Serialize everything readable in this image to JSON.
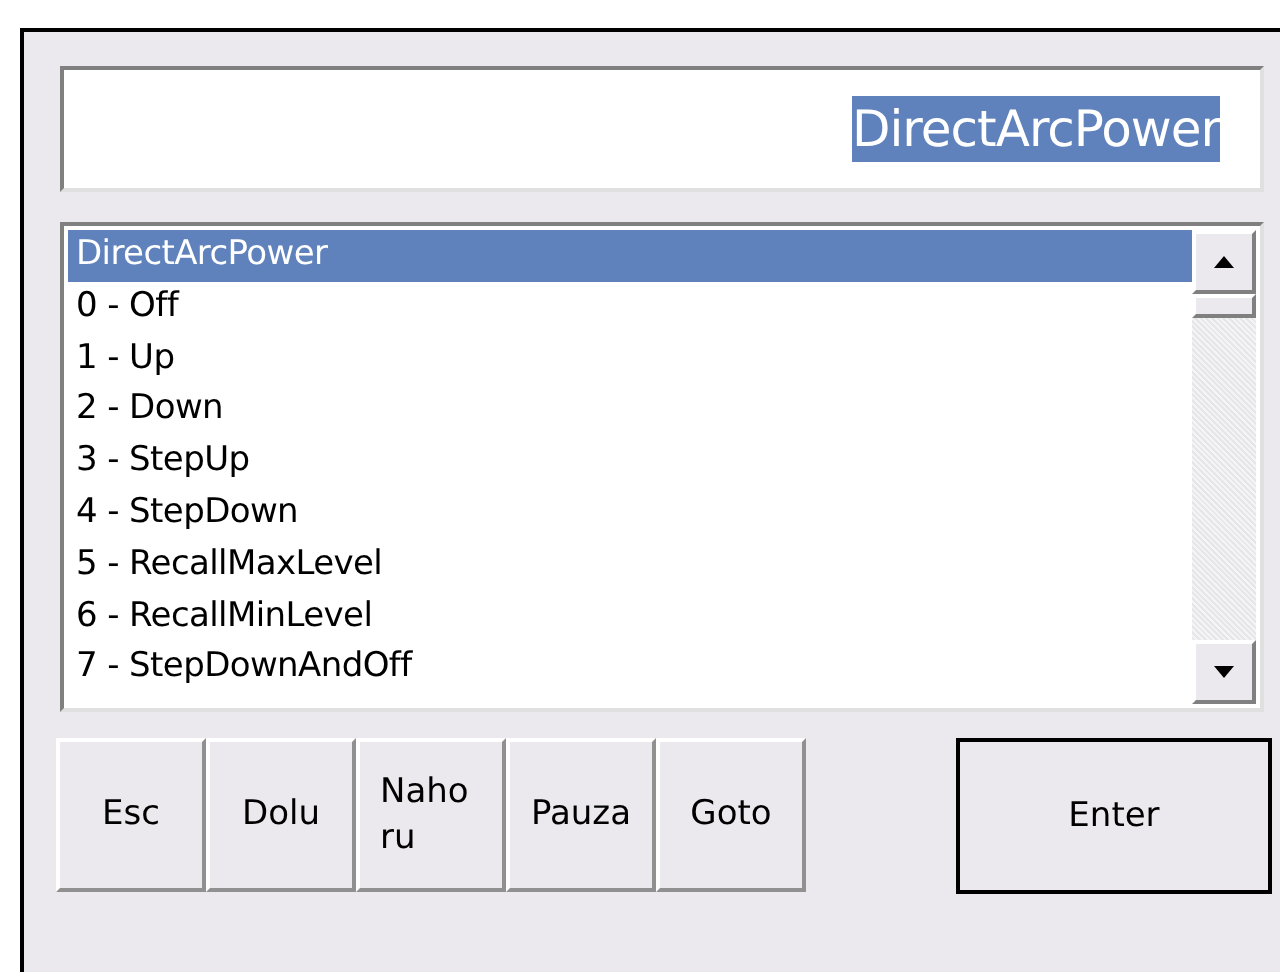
{
  "input": {
    "value": "DirectArcPower",
    "selected": true
  },
  "list": {
    "items": [
      {
        "label": "DirectArcPower",
        "selected": true
      },
      {
        "label": "0 - Off",
        "selected": false
      },
      {
        "label": "1 - Up",
        "selected": false
      },
      {
        "label": "2 - Down",
        "selected": false
      },
      {
        "label": "3 - StepUp",
        "selected": false
      },
      {
        "label": "4 - StepDown",
        "selected": false
      },
      {
        "label": "5 - RecallMaxLevel",
        "selected": false
      },
      {
        "label": "6 - RecallMinLevel",
        "selected": false
      },
      {
        "label": "7 - StepDownAndOff",
        "selected": false
      }
    ]
  },
  "buttons": [
    "Esc",
    "Dolu",
    "Nahoru",
    "Pauza",
    "Goto"
  ],
  "enter_button": {
    "label": "Enter",
    "default": true
  }
}
